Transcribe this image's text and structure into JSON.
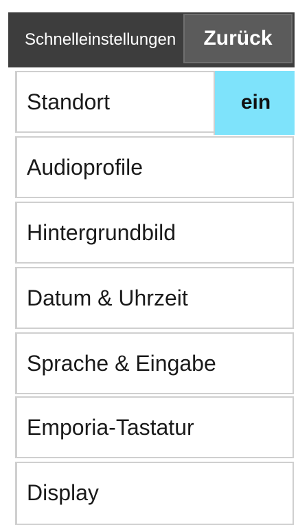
{
  "header": {
    "title": "Schnelleinstellungen",
    "back_label": "Zurück"
  },
  "list": {
    "items": [
      {
        "label": "Standort",
        "toggle": "ein"
      },
      {
        "label": "Audioprofile"
      },
      {
        "label": "Hintergrundbild"
      },
      {
        "label": "Datum & Uhrzeit"
      },
      {
        "label": "Sprache & Eingabe"
      },
      {
        "label": "Emporia-Tastatur"
      },
      {
        "label": "Display"
      }
    ]
  },
  "colors": {
    "header_bg": "#3d3d3d",
    "back_button_bg": "#5b5b5b",
    "toggle_on_bg": "#7ee3fb",
    "row_border": "#cfcfcf"
  }
}
